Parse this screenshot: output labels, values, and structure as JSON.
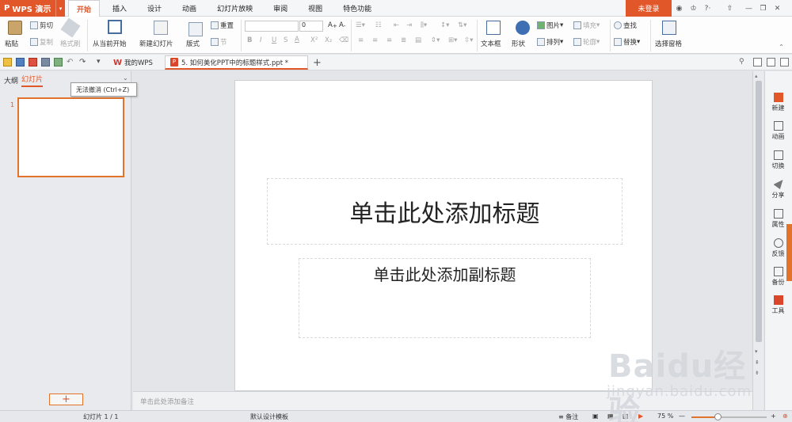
{
  "app": {
    "name": "WPS 演示",
    "logo": "P"
  },
  "menu": {
    "tabs": [
      "开始",
      "插入",
      "设计",
      "动画",
      "幻灯片放映",
      "审阅",
      "视图",
      "特色功能"
    ],
    "active": "开始"
  },
  "login": "未登录",
  "ribbon": {
    "paste": "粘贴",
    "cut": "剪切",
    "copy": "复制",
    "format_painter": "格式刷",
    "from_current": "从当前开始",
    "new_slide": "新建幻灯片",
    "layout": "版式",
    "reset": "重置",
    "section": "节",
    "font_size": "0",
    "bold": "B",
    "italic": "I",
    "underline": "U",
    "strike": "S",
    "font_color": "A",
    "superscript": "X²",
    "subscript": "X₂",
    "textbox": "文本框",
    "shape": "形状",
    "picture": "图片",
    "fill": "填充",
    "arrange": "排列",
    "outline": "轮廓",
    "find": "查找",
    "replace": "替换",
    "select_pane": "选择窗格"
  },
  "doc_tabs": {
    "mywps": "我的WPS",
    "doc": "5. 如何美化PPT中的标题样式.ppt *",
    "add": "+"
  },
  "left_panel": {
    "tab_outline": "大纲",
    "tab_slides": "幻灯片",
    "slide_number": "1",
    "add_label": "+"
  },
  "tooltip": "无法撤消 (Ctrl+Z)",
  "slide": {
    "title_placeholder": "单击此处添加标题",
    "subtitle_placeholder": "单击此处添加副标题"
  },
  "notes_placeholder": "单击此处添加备注",
  "right_pane": [
    {
      "label": "新建",
      "icon": "new-icon"
    },
    {
      "label": "动画",
      "icon": "animation-icon"
    },
    {
      "label": "切换",
      "icon": "transition-icon"
    },
    {
      "label": "分享",
      "icon": "share-icon"
    },
    {
      "label": "属性",
      "icon": "properties-icon"
    },
    {
      "label": "反馈",
      "icon": "feedback-icon"
    },
    {
      "label": "备份",
      "icon": "backup-icon"
    },
    {
      "label": "工具",
      "icon": "tools-icon"
    }
  ],
  "status": {
    "slide_count": "幻灯片 1 / 1",
    "template": "默认设计模板",
    "notes": "备注",
    "zoom": "75 %",
    "zoom_minus": "—",
    "zoom_plus": "+"
  },
  "watermark": {
    "line1": "Baidu经验",
    "line2": "jingyan.baidu.com"
  },
  "colors": {
    "accent": "#e2572a",
    "ribbon_bg": "#fdfdfd"
  }
}
